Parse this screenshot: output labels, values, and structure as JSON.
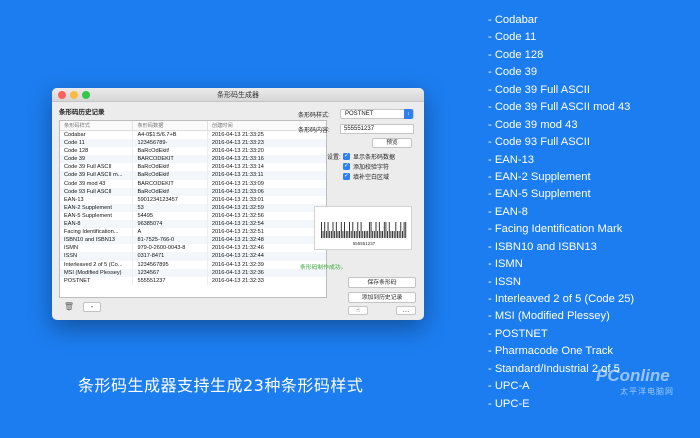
{
  "window": {
    "title": "条形码生成器"
  },
  "history": {
    "title": "条形码历史记录",
    "columns": [
      "条形码样式",
      "条形码数据",
      "创建时间"
    ],
    "rows": [
      [
        "Codabar",
        "A4-0$1:5/6.7+B",
        "2016-04-13 21:33:25"
      ],
      [
        "Code 11",
        "123456789-",
        "2016-04-13 21:33:23"
      ],
      [
        "Code 128",
        "BaRcOdEkit!",
        "2016-04-13 21:33:20"
      ],
      [
        "Code 39",
        "BARCODEKIT",
        "2016-04-13 21:33:16"
      ],
      [
        "Code 39 Full ASCII",
        "BaRcOdEkit!",
        "2016-04-13 21:33:14"
      ],
      [
        "Code 39 Full ASCII m...",
        "BaRcOdEkit!",
        "2016-04-13 21:33:11"
      ],
      [
        "Code 39 mod 43",
        "BARCODEKIT",
        "2016-04-13 21:33:09"
      ],
      [
        "Code 93 Full ASCII",
        "BaRcOdEkit!",
        "2016-04-13 21:33:06"
      ],
      [
        "EAN-13",
        "5901234123457",
        "2016-04-13 21:33:01"
      ],
      [
        "EAN-2 Supplement",
        "53",
        "2016-04-13 21:32:59"
      ],
      [
        "EAN-5 Supplement",
        "54495",
        "2016-04-13 21:32:56"
      ],
      [
        "EAN-8",
        "96385074",
        "2016-04-13 21:32:54"
      ],
      [
        "Facing Identification...",
        "A",
        "2016-04-13 21:32:51"
      ],
      [
        "ISBN10 and ISBN13",
        "81-7525-766-0",
        "2016-04-13 21:32:48"
      ],
      [
        "ISMN",
        "979-0-2600-0043-8",
        "2016-04-13 21:32:46"
      ],
      [
        "ISSN",
        "0317-8471",
        "2016-04-13 21:32:44"
      ],
      [
        "Interleaved 2 of 5 (Co...",
        "1234567895",
        "2016-04-13 21:32:39"
      ],
      [
        "MSI (Modified Plessey)",
        "1234567",
        "2016-04-13 21:32:36"
      ],
      [
        "POSTNET",
        "555551237",
        "2016-04-13 21:32:33"
      ]
    ]
  },
  "form": {
    "style_label": "条形码样式:",
    "style_value": "POSTNET",
    "content_label": "条形码内容:",
    "content_value": "555551237",
    "preview_button": "预览",
    "settings_label": "设置:",
    "options": [
      "显示条形码数据",
      "添加校验字符",
      "填补空白区域"
    ],
    "barcode_text": "555551237",
    "status_text": "条形码制作成功。",
    "save_button": "保存条形码",
    "add_history_button": "添加到历史记录"
  },
  "caption": "条形码生成器支持生成23种条形码样式",
  "codelist": [
    "- Codabar",
    "- Code 11",
    "- Code 128",
    "- Code 39",
    "- Code 39 Full ASCII",
    "- Code 39 Full ASCII mod 43",
    "- Code 39 mod 43",
    "- Code 93 Full ASCII",
    "- EAN-13",
    "- EAN-2 Supplement",
    "- EAN-5 Supplement",
    "- EAN-8",
    "- Facing Identification Mark",
    "- ISBN10 and ISBN13",
    "- ISMN",
    "- ISSN",
    "- Interleaved 2 of 5 (Code 25)",
    "- MSI (Modified Plessey)",
    "- POSTNET",
    "- Pharmacode One Track",
    "- Standard/Industrial 2 of 5",
    "- UPC-A",
    "- UPC-E"
  ],
  "watermark": {
    "main": "PConline",
    "sub": "太平洋电脑网"
  },
  "colors": {
    "background": "#1c7df0",
    "accent": "#2f7ff7",
    "success": "#3aa83a"
  },
  "icons": {
    "trash": "trash-icon",
    "dropdown": "chevron-updown-icon",
    "checkbox": "checkmark-icon"
  }
}
